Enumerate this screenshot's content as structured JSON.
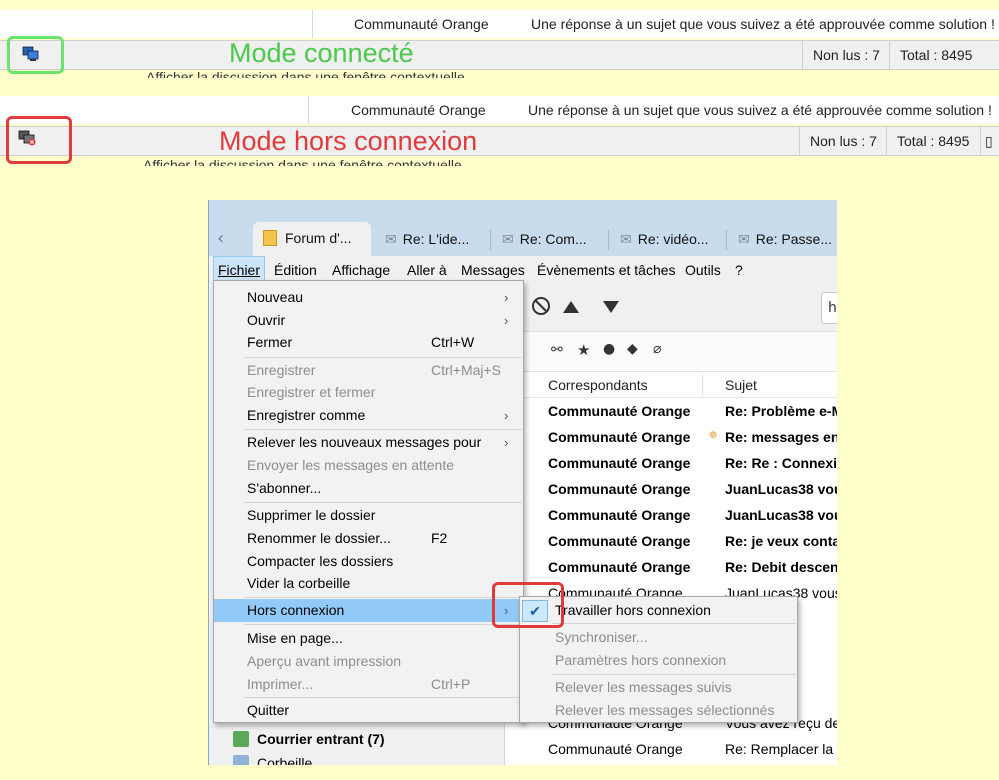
{
  "strip_connected": {
    "sender": "Communauté Orange",
    "subject": "Une réponse à un sujet que vous suivez a été approuvée comme solution !",
    "mode_label": "Mode connecté",
    "unread": "Non lus : 7",
    "total": "Total : 8495",
    "ghost": "Afficher la discussion dans une fenêtre contextuelle",
    "label_color": "#4cc94c",
    "box_color": "#6be46b"
  },
  "strip_offline": {
    "sender": "Communauté Orange",
    "subject": "Une réponse à un sujet que vous suivez a été approuvée comme solution !",
    "mode_label": "Mode hors connexion",
    "unread": "Non lus : 7",
    "total": "Total : 8495",
    "ghost": "Afficher la discussion dans une fenêtre contextuelle",
    "label_color": "#e23b3b",
    "box_color": "#e23b3b"
  },
  "tabs": [
    {
      "label": "Forum d'..."
    },
    {
      "label": "Re: L'ide..."
    },
    {
      "label": "Re: Com..."
    },
    {
      "label": "Re: vidéo..."
    },
    {
      "label": "Re: Passe..."
    }
  ],
  "menubar": {
    "fichier": "Fichier",
    "edition": "Édition",
    "affichage": "Affichage",
    "aller": "Aller à",
    "messages": "Messages",
    "evenements": "Évènements et tâches",
    "outils": "Outils",
    "aide": "?"
  },
  "search_value": "h",
  "columns": {
    "correspondants": "Correspondants",
    "sujet": "Sujet"
  },
  "messages": [
    {
      "from": "Communauté Orange",
      "subject": "Re: Problème e-M"
    },
    {
      "from": "Communauté Orange",
      "subject": "Re: messages ent"
    },
    {
      "from": "Communauté Orange",
      "subject": "Re: Re : Connexio"
    },
    {
      "from": "Communauté Orange",
      "subject": "JuanLucas38 vou"
    },
    {
      "from": "Communauté Orange",
      "subject": "JuanLucas38 vou"
    },
    {
      "from": "Communauté Orange",
      "subject": "Re: je veux conta"
    },
    {
      "from": "Communauté Orange",
      "subject": "Re: Debit descenc"
    },
    {
      "from": "Communauté Orange",
      "subject": "JuanLucas38 vous"
    },
    {
      "from": "",
      "subject": "R L ICO"
    },
    {
      "from": "",
      "subject": "vous a"
    },
    {
      "from": "",
      "subject": "es entr"
    },
    {
      "from": "",
      "subject": "es entr"
    },
    {
      "from": "Communauté Orange",
      "subject": "Vous avez reçu des"
    },
    {
      "from": "Communauté Orange",
      "subject": "Re: Remplacer la l"
    }
  ],
  "folders": {
    "inbox": "Courrier entrant (7)",
    "trash": "Corbeille"
  },
  "file_menu": {
    "nouveau": "Nouveau",
    "ouvrir": "Ouvrir",
    "fermer": "Fermer",
    "fermer_sc": "Ctrl+W",
    "enregistrer": "Enregistrer",
    "enregistrer_sc": "Ctrl+Maj+S",
    "enregistrer_fermer": "Enregistrer et fermer",
    "enregistrer_comme": "Enregistrer comme",
    "relever": "Relever les nouveaux messages pour",
    "envoyer": "Envoyer les messages en attente",
    "abonner": "S'abonner...",
    "supprimer": "Supprimer le dossier",
    "renommer": "Renommer le dossier...",
    "renommer_sc": "F2",
    "compacter": "Compacter les dossiers",
    "vider": "Vider la corbeille",
    "hors_connexion": "Hors connexion",
    "mise_en_page": "Mise en page...",
    "apercu": "Aperçu avant impression",
    "imprimer": "Imprimer...",
    "imprimer_sc": "Ctrl+P",
    "quitter": "Quitter"
  },
  "offline_submenu": {
    "travailler": "Travailler hors connexion",
    "synchroniser": "Synchroniser...",
    "parametres": "Paramètres hors connexion",
    "relever_suivis": "Relever les messages suivis",
    "relever_selection": "Relever les messages sélectionnés"
  },
  "colors": {
    "menu_highlight": "#91c9f7",
    "tabbar": "#c9dced",
    "annotation_red": "#e23b3b"
  }
}
